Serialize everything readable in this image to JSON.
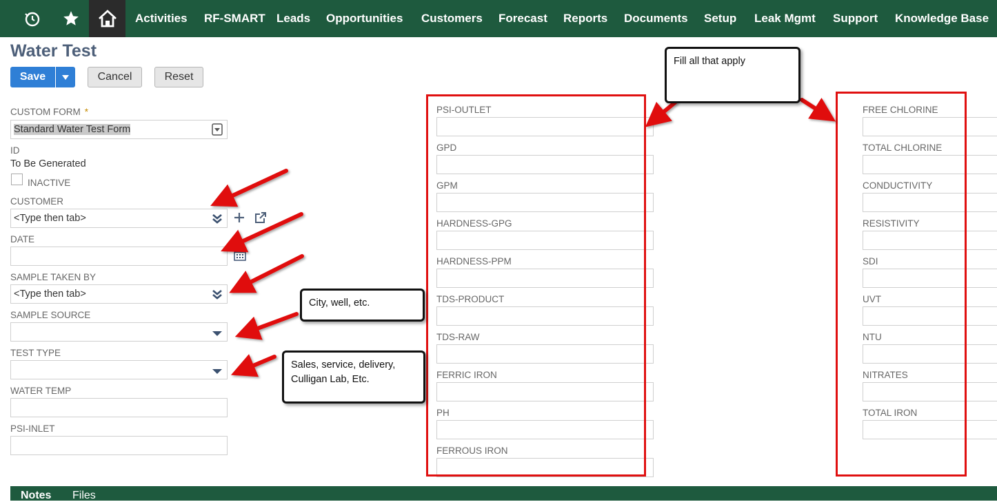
{
  "nav": {
    "items": [
      "Activities",
      "RF-SMART",
      "Leads",
      "Opportunities",
      "Customers",
      "Forecast",
      "Reports",
      "Documents",
      "Setup",
      "Leak Mgmt",
      "Support",
      "Knowledge Base"
    ],
    "icons": [
      "recent-icon",
      "star-icon",
      "home-icon"
    ]
  },
  "page": {
    "title": "Water Test",
    "save_label": "Save",
    "cancel_label": "Cancel",
    "reset_label": "Reset"
  },
  "form": {
    "custom_form_label": "CUSTOM FORM",
    "required_mark": "*",
    "custom_form_value": "Standard Water Test Form",
    "id_label": "ID",
    "id_value": "To Be Generated",
    "inactive_label": "INACTIVE",
    "customer_label": "CUSTOMER",
    "customer_value": "<Type then tab>",
    "date_label": "DATE",
    "sample_taken_by_label": "SAMPLE TAKEN BY",
    "sample_taken_by_value": "<Type then tab>",
    "sample_source_label": "SAMPLE SOURCE",
    "test_type_label": "TEST TYPE",
    "water_temp_label": "WATER TEMP",
    "psi_inlet_label": "PSI-INLET"
  },
  "middle_fields": [
    "PSI-OUTLET",
    "GPD",
    "GPM",
    "HARDNESS-GPG",
    "HARDNESS-PPM",
    "TDS-PRODUCT",
    "TDS-RAW",
    "FERRIC IRON",
    "PH",
    "FERROUS IRON"
  ],
  "right_fields": [
    "FREE CHLORINE",
    "TOTAL CHLORINE",
    "CONDUCTIVITY",
    "RESISTIVITY",
    "SDI",
    "UVT",
    "NTU",
    "NITRATES",
    "TOTAL IRON"
  ],
  "annotations": {
    "fill_all": "Fill all that apply",
    "sample_source_note": "City, well, etc.",
    "test_type_note_line1": "Sales, service, delivery,",
    "test_type_note_line2": "Culligan Lab, Etc."
  },
  "footer": {
    "tabs": [
      "Notes",
      "Files"
    ]
  },
  "colors": {
    "nav_bg": "#1e5a3e",
    "save_blue": "#2f7fd6",
    "annotation_red": "#e01010",
    "title_color": "#4d5f79"
  }
}
